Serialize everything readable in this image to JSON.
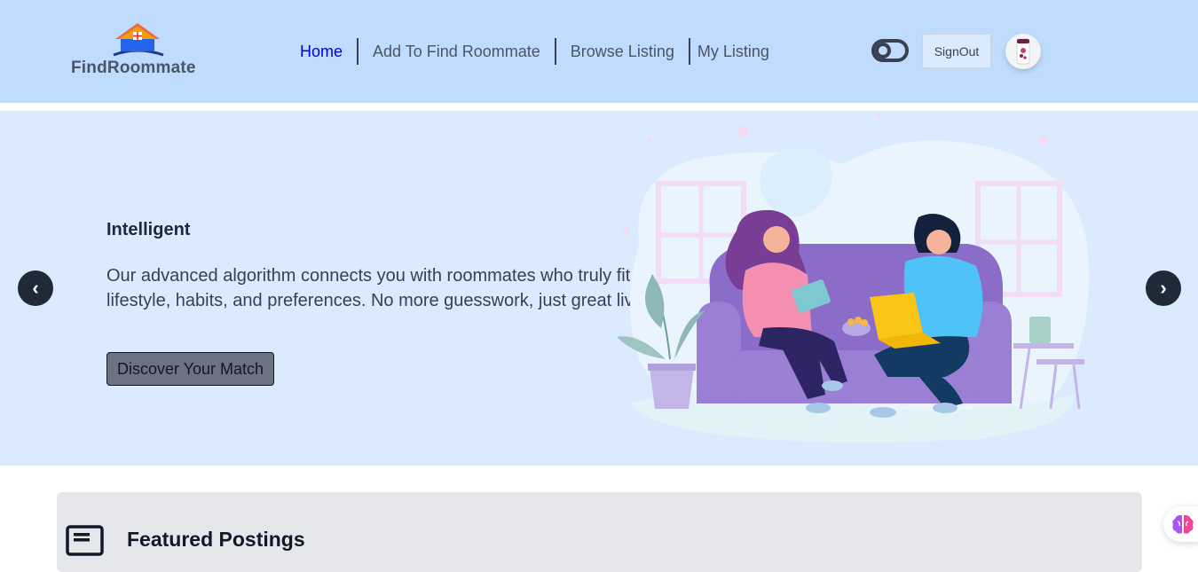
{
  "header": {
    "logo_text": "FindRoommate",
    "nav": [
      {
        "label": "Home",
        "active": true
      },
      {
        "label": "Add To Find Roommate",
        "active": false
      },
      {
        "label": "Browse Listing",
        "active": false
      },
      {
        "label": "My Listing",
        "active": false
      }
    ],
    "signout_label": "SignOut"
  },
  "hero": {
    "title": "Intelligent",
    "description": "Our advanced algorithm connects you with roommates who truly fit your lifestyle, habits, and preferences. No more guesswork, just great living.",
    "button_label": "Discover Your Match",
    "prev_label": "‹",
    "next_label": "›"
  },
  "featured": {
    "title": "Featured Postings"
  },
  "icons": {
    "logo": "house-logo-icon",
    "theme": "theme-toggle-icon",
    "featured": "postings-card-icon",
    "assistant": "brain-icon"
  },
  "colors": {
    "navbar_bg": "#bfdbfe",
    "hero_bg": "#dbeafe",
    "active_link": "#0000cd",
    "featured_bg": "#e5e7eb"
  }
}
